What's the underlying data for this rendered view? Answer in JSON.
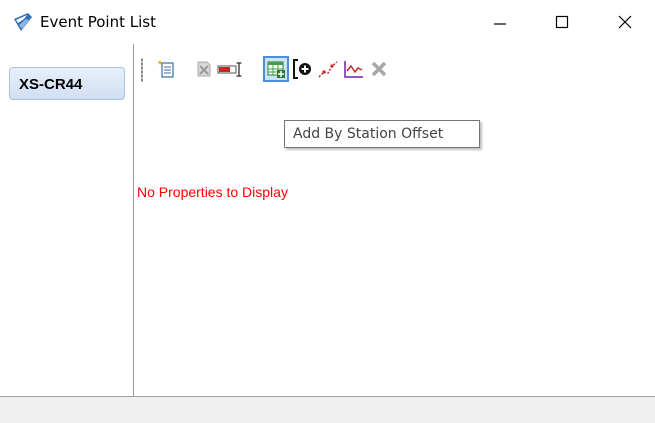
{
  "window": {
    "title": "Event Point List",
    "app_icon": "civil-app-icon",
    "minimize_icon": "minimize-icon",
    "maximize_icon": "maximize-icon",
    "close_icon": "close-icon"
  },
  "sidebar": {
    "items": [
      {
        "label": "XS-CR44",
        "selected": true
      }
    ]
  },
  "toolbar": {
    "buttons": [
      {
        "icon": "new-document-icon",
        "enabled": true
      },
      {
        "icon": "delete-document-icon",
        "enabled": false
      },
      {
        "icon": "rename-icon",
        "enabled": true
      },
      {
        "icon": "add-by-station-offset-icon",
        "enabled": true,
        "active": true
      },
      {
        "icon": "add-point-icon",
        "enabled": true
      },
      {
        "icon": "pick-points-icon",
        "enabled": true
      },
      {
        "icon": "profile-graph-icon",
        "enabled": true
      },
      {
        "icon": "remove-icon",
        "enabled": false
      }
    ]
  },
  "tooltip": {
    "text": "Add By Station Offset"
  },
  "main": {
    "message": "No Properties to Display"
  },
  "colors": {
    "message": "#ff0000",
    "active_button_border": "#4d8fdc",
    "active_button_fill": "#cce4f7",
    "tab_fill": "#d9e6f6"
  }
}
